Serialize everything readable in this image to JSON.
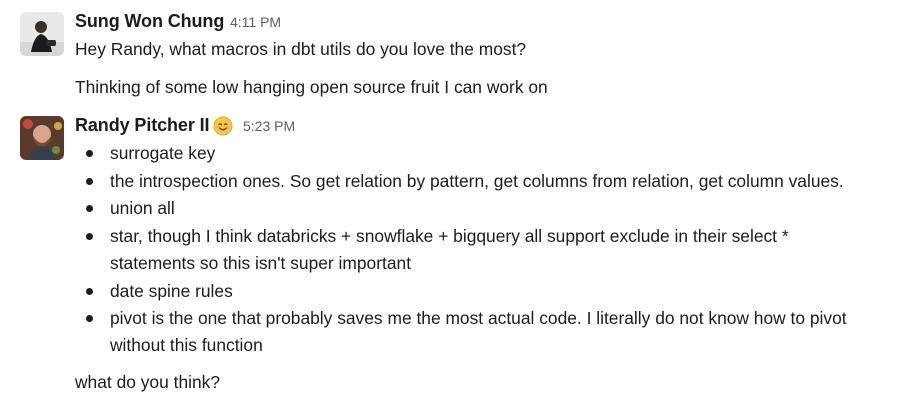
{
  "messages": [
    {
      "author": "Sung Won Chung",
      "time": "4:11 PM",
      "lines": [
        "Hey Randy, what macros in dbt utils do you love the most?",
        "Thinking of some low hanging open source fruit I can work on"
      ]
    },
    {
      "author": "Randy Pitcher II",
      "time": "5:23 PM",
      "status_emoji": "smiling-face-emoji",
      "bullets": [
        "surrogate key",
        "the introspection ones. So get relation by pattern, get columns from relation, get column values.",
        "union all",
        "star, though I think databricks + snowflake + bigquery all support exclude in their select *",
        "statements so this isn't super important",
        "date spine rules",
        "pivot is the one that probably saves me the most actual code. I literally do not know how to pivot",
        "without this function"
      ],
      "closing": "what do you think?"
    }
  ],
  "colors": {
    "text": "#1d1c1d",
    "timestamp": "#616061",
    "background": "#ffffff"
  }
}
